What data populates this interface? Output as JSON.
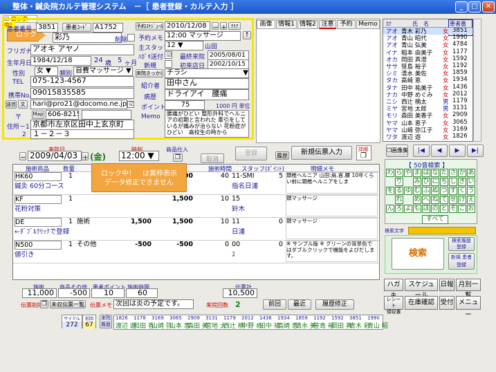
{
  "window": {
    "title": "整体・鍼灸院カルテ管理システム　－［ 患者登録・カルテ入力 ］"
  },
  "lock": {
    "checkbox_label": "ロック中！",
    "tip_label": "ロック",
    "overlay_line1": "ロック中！　は黄枠表示",
    "overlay_line2": "データ修正できません"
  },
  "patient": {
    "no_label": "患者番号",
    "no": "3851",
    "code_label": "患者ｺｰﾄﾞ",
    "code": "A1752",
    "name_label": "氏名",
    "name": "彩乃",
    "delete_label": "削除",
    "kana_label": "フリガナ",
    "kana": "アオキ アヤノ",
    "dob_label": "生年月日",
    "dob": "1984/12/18",
    "age": "24",
    "age_unit": "歳",
    "months": "5",
    "months_unit": "ヶ月",
    "sex_label": "性別",
    "sex": "女",
    "type_label": "類別",
    "type": "自費マッサージ",
    "tel_label": "TEL",
    "tel": "075-123-4567",
    "mobile_label": "携帯No.",
    "mobile": "09015835585",
    "mail_btn": "送信",
    "mail_btn2": "文",
    "email": "hari@pro21@docomo.ne.jp",
    "zip_label": "〒",
    "map_btn": "Map",
    "zip": "606-8215",
    "addr_label1": "住所－1",
    "addr_label2": "2",
    "addr1": "京都市左京区田中上玄京町",
    "addr2": "１－２－３"
  },
  "schedule": {
    "date_label": "予約ｽｹｼﾞｭｰﾙ",
    "date": "2010/12/08",
    "minus": "－",
    "plus": "＋",
    "clear": "ｸﾘｱ",
    "memo_label": "予約メモ",
    "memo": "12:00 マッサージ",
    "staff_label": "主スタッフ",
    "staff_no": "12",
    "staff": "山田",
    "hagaki_label": "ﾊｶﾞｷ送付",
    "last_label": "最終来院",
    "last": "2005/08/01",
    "new_label": "新規",
    "first_label": "初来店日",
    "first": "2002/10/15",
    "trigger_label": "来院きっかけ",
    "trigger": "チラシ",
    "ref_label": "紹介者",
    "ref": "田中さん",
    "cond_label": "病歴",
    "cond": "ドライアイ　腰痛",
    "point_label": "ポイント",
    "point": "75",
    "point_rate": "1000 円 単位",
    "memo2_label": "Memo",
    "memo2": "腰痛がひどい 整形外科でヘルニアの初期と言われた 牽引をしているが痛みが治らない 花粉症がひどい　高校生の時から"
  },
  "tabs": [
    "画像",
    "情報1",
    "情報2",
    "注意",
    "予約",
    "Memo"
  ],
  "patient_list": {
    "headers": [
      "ｶﾅ",
      "氏　名",
      "患者番号"
    ],
    "rows": [
      [
        "アオ",
        "青木 彩乃",
        "女",
        "3851"
      ],
      [
        "アオ",
        "青山 昭代",
        "女",
        "1990"
      ],
      [
        "アオ",
        "青山 弘美",
        "女",
        "4784"
      ],
      [
        "イナ",
        "稲本 由美子",
        "女",
        "1177"
      ],
      [
        "オカ",
        "岡田 真澄",
        "女",
        "1592"
      ],
      [
        "ササ",
        "笹島 裕子",
        "女",
        "1192"
      ],
      [
        "シミ",
        "清水 美佐",
        "女",
        "1859"
      ],
      [
        "タカ",
        "高崎 恵",
        "女",
        "1934"
      ],
      [
        "タナ",
        "田中 祐美子",
        "女",
        "1436"
      ],
      [
        "ナカ",
        "中野 めぐみ",
        "女",
        "2012"
      ],
      [
        "ニシ",
        "西辻 楠太",
        "男",
        "1179"
      ],
      [
        "ミヤ",
        "宮地 太郎",
        "男",
        "3131"
      ],
      [
        "モリ",
        "森田 美香子",
        "女",
        "2909"
      ],
      [
        "ヤマ",
        "山本 恵子",
        "女",
        "3065"
      ],
      [
        "ヤマ",
        "山崎 弥江子",
        "女",
        "3169"
      ],
      [
        "ワタ",
        "渡辺 遊",
        "女",
        "1826"
      ]
    ]
  },
  "visit": {
    "date_label": "来院日",
    "date": "2009/04/03",
    "dow": "(金)",
    "time_label": "時刻",
    "time": "12:00",
    "goods_label": "商品仕入",
    "cancel": "取消",
    "register": "登録",
    "history": "履歴",
    "new_slip": "新規伝票入力",
    "detail": "詳細"
  },
  "slip": {
    "headers": [
      "施術商品",
      "数量",
      "単価",
      "",
      "金額",
      "施術時間",
      "スタッフ(ﾎﾟｲﾝﾄ)",
      "明細メモ"
    ],
    "rows": [
      {
        "item": "HK60",
        "qty": "1",
        "type": "",
        "price": "",
        "amount": "8,000",
        "time": "40",
        "staff": "11-SMI",
        "pt": "5",
        "sub": "鍼灸 60分コース",
        "staff_name": "指名日浦",
        "memo": "頚椎ヘルニア 山田:肩.首.腰 10年くらい前に頚椎ヘルニアをしま"
      },
      {
        "item": "KF",
        "qty": "1",
        "type": "",
        "price": "",
        "amount": "1,500",
        "time": "10",
        "staff": "15",
        "pt": "",
        "sub": "花粉対策",
        "staff_name": "鈴木",
        "memo": "頚マッサージ"
      },
      {
        "item": "DE",
        "qty": "1",
        "type": "施術",
        "price": "1,500",
        "amount": "1,500",
        "time": "10",
        "staff": "11",
        "pt": "0",
        "sub": "←ﾀﾞﾌﾞﾙｸﾘｯｸで登録",
        "staff_name": "日浦",
        "memo": "頚マッサージ"
      },
      {
        "item": "N500",
        "qty": "1",
        "type": "その他",
        "price": "-500",
        "amount": "-500",
        "time": "0",
        "staff": "00",
        "pt": "0",
        "sub": "値引き",
        "staff_name": "ｽ",
        "memo": "※ サンプル版 ※ グリーンの背景色ではダブルクリックで機能をよびだします。"
      }
    ]
  },
  "totals": {
    "treat_label": "施術",
    "treat": "11,000",
    "goods_label": "商品その他",
    "goods": "-500",
    "pt_label": "患者ポイント",
    "pt": "10",
    "time_label": "施術時間",
    "time": "60",
    "total_label": "伝票計",
    "total": "10,500",
    "delete_label": "伝票削除",
    "unpaid_label": "未収伝票一覧",
    "memo_label": "伝票メモ",
    "memo": "次回は炎の予定です。",
    "visits_label": "来院回数",
    "visits": "2",
    "prev": "前回",
    "latest": "最近",
    "history": "履歴修正"
  },
  "counters": {
    "cycle_label": "サイクル",
    "cycle": "272",
    "days_label": "前回",
    "days": "67",
    "recent_label": "来院履歴"
  },
  "recent": [
    {
      "no": "1826",
      "name": "渡辺 遊"
    },
    {
      "no": "1178",
      "name": "和田 香"
    },
    {
      "no": "3169",
      "name": "山崎 弥"
    },
    {
      "no": "3065",
      "name": "山本 恵"
    },
    {
      "no": "2909",
      "name": "森田 美"
    },
    {
      "no": "3131",
      "name": "宮地 太"
    },
    {
      "no": "1179",
      "name": "西辻 楠"
    },
    {
      "no": "2012",
      "name": "中野 め"
    },
    {
      "no": "1436",
      "name": "田中 祐"
    },
    {
      "no": "1934",
      "name": "高崎 恵"
    },
    {
      "no": "1859",
      "name": "清水 美"
    },
    {
      "no": "1192",
      "name": "笹島 裕"
    },
    {
      "no": "1592",
      "name": "岡田 真"
    },
    {
      "no": "3851",
      "name": "青木 彩"
    },
    {
      "no": "1990",
      "name": "青山 昭"
    }
  ],
  "kana_search": {
    "title": "【 50音検索 】",
    "rows": [
      [
        "わ",
        "ら",
        "や",
        "ま",
        "は",
        "な",
        "た",
        "さ",
        "か",
        "あ"
      ],
      [
        "",
        "り",
        "",
        "み",
        "ひ",
        "に",
        "ち",
        "し",
        "き",
        "い"
      ],
      [
        "を",
        "る",
        "ゆ",
        "む",
        "ふ",
        "ぬ",
        "つ",
        "す",
        "く",
        "う"
      ],
      [
        "",
        "れ",
        "",
        "め",
        "へ",
        "ね",
        "て",
        "せ",
        "け",
        "え"
      ],
      [
        "ん",
        "ろ",
        "よ",
        "も",
        "ほ",
        "の",
        "と",
        "そ",
        "こ",
        "お"
      ]
    ],
    "all": "すべて",
    "search_text_label": "検索文字",
    "search": "検索",
    "detail_search": "検索履歴 登録",
    "new_register": "新規 患者登録"
  },
  "nav": {
    "image_btn": "画像集",
    "first": "|◀",
    "prev": "◀",
    "next": "▶",
    "last": "▶|"
  },
  "fn_buttons": [
    [
      "ハガキ",
      "スケジュール",
      "日報",
      "月別一覧"
    ],
    [
      "レシート",
      "在庫確認",
      "受付",
      "メニュー"
    ]
  ],
  "receipt_sub": "領収書"
}
